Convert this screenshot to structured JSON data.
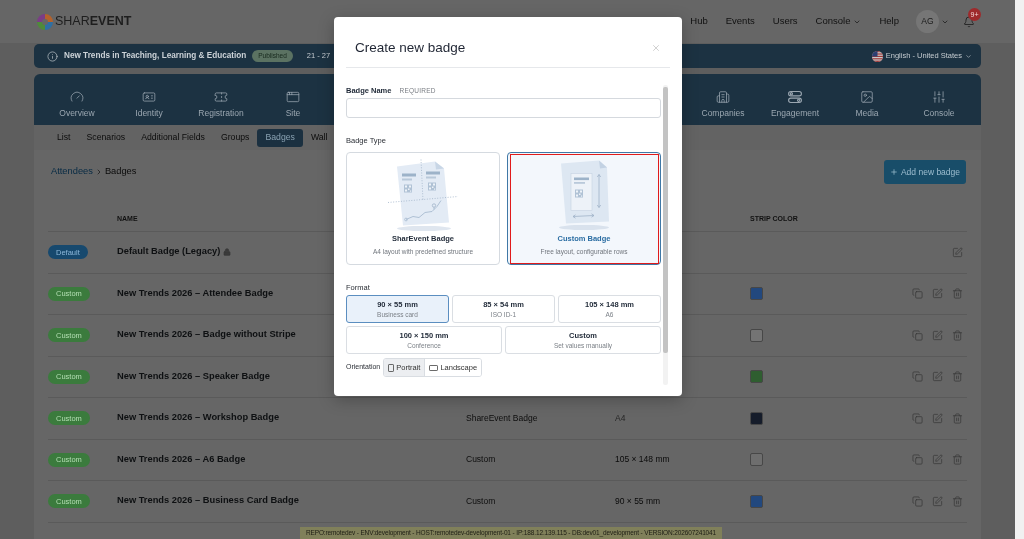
{
  "header": {
    "logo": "SHAR**EVENT**",
    "nav": [
      {
        "label": "Hub",
        "dropdown": false
      },
      {
        "label": "Events",
        "dropdown": false
      },
      {
        "label": "Users",
        "dropdown": false
      },
      {
        "label": "Console",
        "dropdown": true
      },
      {
        "label": "Help",
        "dropdown": false
      }
    ],
    "avatar": "AG",
    "notification_count": "9+"
  },
  "event_bar": {
    "title": "New Trends in Teaching, Learning & Education",
    "status": "Published",
    "dates": "21 - 27",
    "language": "English - United States"
  },
  "module_nav": {
    "left": [
      "Overview",
      "Identity",
      "Registration",
      "Site"
    ],
    "right": [
      "Companies",
      "Engagement",
      "Media",
      "Console"
    ]
  },
  "subtabs": [
    {
      "label": "List",
      "selected": false
    },
    {
      "label": "Scenarios",
      "selected": false
    },
    {
      "label": "Additional Fields",
      "selected": false
    },
    {
      "label": "Groups",
      "selected": false
    },
    {
      "label": "Badges",
      "selected": true
    },
    {
      "label": "Wall",
      "selected": false
    }
  ],
  "breadcrumb": [
    "Attendees",
    "Badges"
  ],
  "add_button": "Add new badge",
  "table": {
    "columns": [
      "NAME",
      "STRIP COLOR"
    ],
    "rows": [
      {
        "tag": "Default",
        "kind": "default",
        "name": "Default Badge (Legacy)",
        "locked": true
      },
      {
        "tag": "Custom",
        "kind": "custom",
        "name": "New Trends 2026 – Attendee Badge",
        "locked": false,
        "color": "#22487e"
      },
      {
        "tag": "Custom",
        "kind": "custom",
        "name": "New Trends 2026 – Badge without Stripe",
        "locked": false,
        "color": "#747474"
      },
      {
        "tag": "Custom",
        "kind": "custom",
        "name": "New Trends 2026 – Speaker Badge",
        "locked": false,
        "color": "#2f5e30"
      },
      {
        "tag": "Custom",
        "kind": "custom",
        "name": "New Trends 2026 – Workshop Badge",
        "locked": false,
        "type": "ShareEvent Badge",
        "format": {
          "text": "A4",
          "muted": true
        },
        "color": "#151c2a"
      },
      {
        "tag": "Custom",
        "kind": "custom",
        "name": "New Trends 2026 – A6 Badge",
        "locked": false,
        "type": "Custom",
        "format": {
          "text": "105 × 148 mm",
          "muted": false
        },
        "color": "#6e6e6e"
      },
      {
        "tag": "Custom",
        "kind": "custom",
        "name": "New Trends 2026 – Business Card Badge",
        "locked": false,
        "type": "Custom",
        "format": {
          "text": "90 × 55 mm",
          "muted": false
        },
        "color": "#22487e"
      }
    ]
  },
  "env_bar": "REPO:remotedev - ENV:development - HOST:remotedev-development-01 - IP:188.12.139.115 - DB:dev01_development - VERSION:202607241041",
  "modal": {
    "title": "Create new badge",
    "name_field": {
      "label": "Badge Name",
      "required": "REQUIRED"
    },
    "badge_type": {
      "label": "Badge Type",
      "options": [
        {
          "title": "SharEvent Badge",
          "description": "A4 layout with predefined structure",
          "selected": false,
          "focused": false
        },
        {
          "title": "Custom Badge",
          "description": "Free layout, configurable rows",
          "selected": true,
          "focused": true
        }
      ]
    },
    "format": {
      "label": "Format",
      "rows": [
        [
          {
            "size": "90 × 55 mm",
            "name": "Business card",
            "selected": true
          },
          {
            "size": "85 × 54 mm",
            "name": "ISO ID-1",
            "selected": false
          },
          {
            "size": "105 × 148 mm",
            "name": "A6",
            "selected": false
          }
        ],
        [
          {
            "size": "100 × 150 mm",
            "name": "Conference",
            "selected": false
          },
          {
            "size": "Custom",
            "name": "Set values manually",
            "selected": false
          }
        ]
      ]
    },
    "orientation": {
      "label": "Orientation",
      "options": [
        {
          "label": "Portrait",
          "selected": true
        },
        {
          "label": "Landscape",
          "selected": false
        }
      ]
    }
  }
}
